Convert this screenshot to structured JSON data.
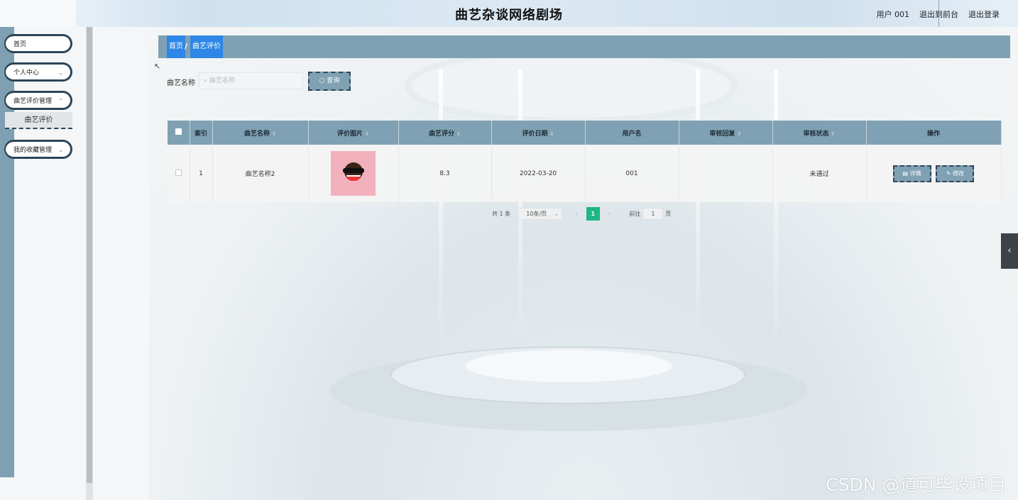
{
  "header": {
    "title": "曲艺杂谈网络剧场",
    "user_label": "用户 001",
    "to_front_label": "退出到前台",
    "logout_label": "退出登录"
  },
  "sidebar": {
    "items": [
      {
        "label": "首页"
      },
      {
        "label": "个人中心"
      },
      {
        "label": "曲艺评价管理"
      },
      {
        "label": "我的收藏管理"
      }
    ],
    "subitem": "曲艺评价"
  },
  "breadcrumb": {
    "home": "首页",
    "separator": "/",
    "current": "曲艺评价"
  },
  "search": {
    "label": "曲艺名称",
    "placeholder": "曲艺名称",
    "button_label": "查询"
  },
  "table": {
    "columns": [
      "索引",
      "曲艺名称",
      "评价图片",
      "曲艺评分",
      "评价日期",
      "用户名",
      "审核回复",
      "审核状态",
      "操作"
    ],
    "rows": [
      {
        "index": "1",
        "name": "曲艺名称2",
        "score": "8.3",
        "date": "2022-03-20",
        "username": "001",
        "reply": "",
        "status": "未通过",
        "detail_label": "详情",
        "edit_label": "修改"
      }
    ]
  },
  "pagination": {
    "total": "共 1 条",
    "page_size": "10条/页",
    "current_page": "1",
    "goto_label": "前往",
    "goto_value": "1",
    "page_unit": "页"
  },
  "watermark": "CSDN @道可毕设项目",
  "colors": {
    "accent": "#7fa1b3",
    "dark_border": "#2c4559",
    "breadcrumb_highlight": "#2e87e6",
    "page_active": "#20b585"
  }
}
